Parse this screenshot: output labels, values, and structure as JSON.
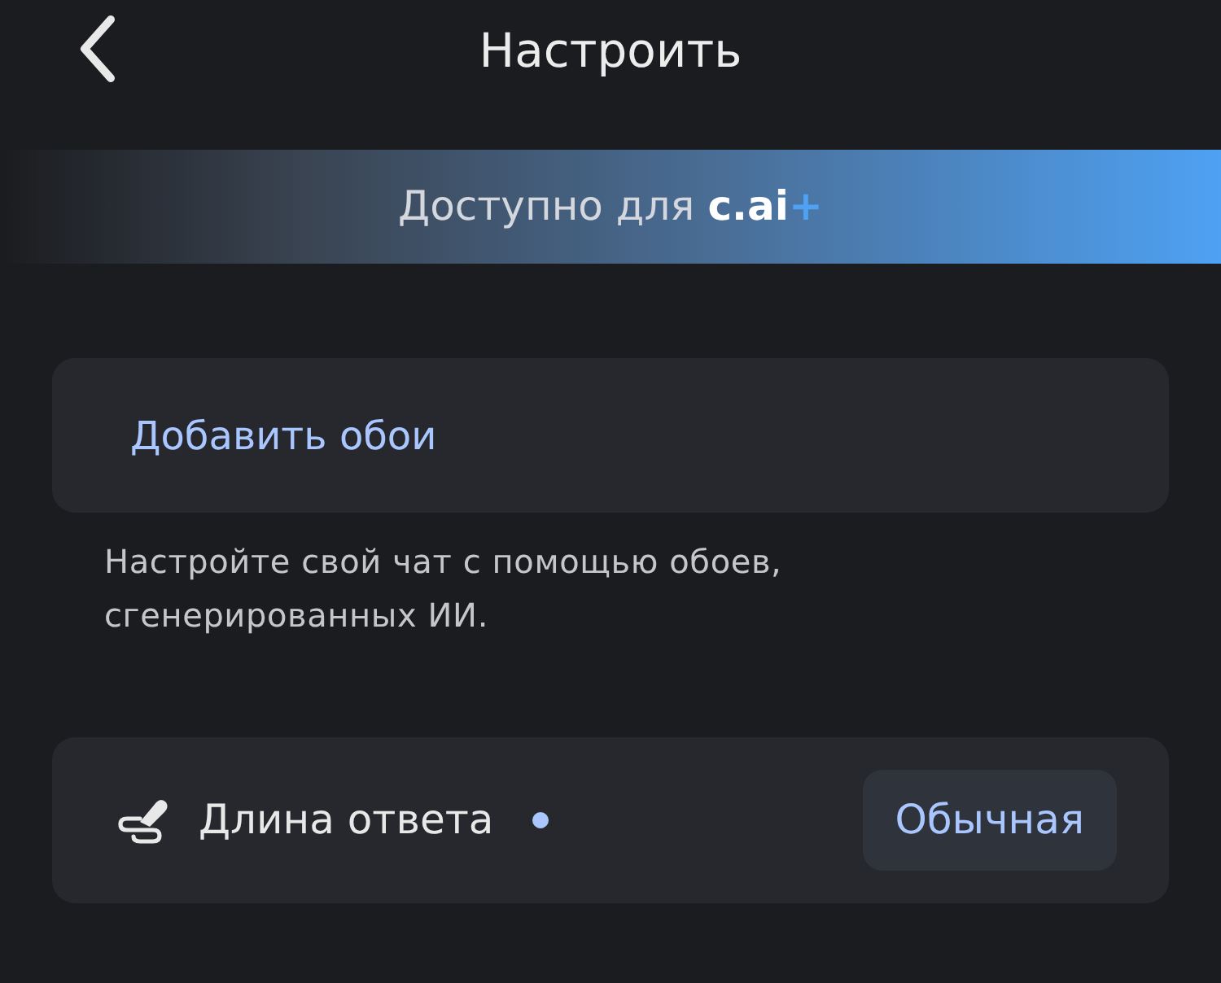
{
  "header": {
    "title": "Настроить"
  },
  "banner": {
    "text": "Доступно для",
    "brand": "c.ai",
    "brand_mark": "+"
  },
  "wallpaper": {
    "button": "Добавить обои",
    "caption": "Настройте свой чат с помощью обоев, сгенерированных ИИ."
  },
  "response_length": {
    "label": "Длина ответа",
    "new_indicator": true,
    "value": "Обычная"
  }
}
